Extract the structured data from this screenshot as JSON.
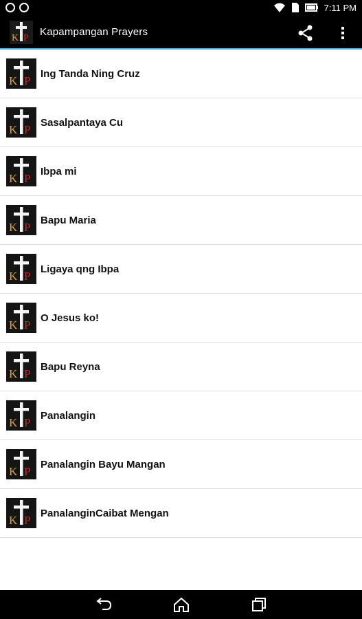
{
  "status_bar": {
    "time": "7:11 PM",
    "icons": [
      "notification-icon",
      "notification-icon",
      "wifi-icon",
      "sim-icon",
      "battery-icon"
    ]
  },
  "app_bar": {
    "title": "Kapampangan Prayers",
    "actions": [
      "share-icon",
      "more-vert-icon"
    ]
  },
  "prayers": [
    {
      "label": "Ing Tanda Ning Cruz"
    },
    {
      "label": "Sasalpantaya Cu"
    },
    {
      "label": "Ibpa mi"
    },
    {
      "label": "Bapu Maria"
    },
    {
      "label": "Ligaya qng Ibpa"
    },
    {
      "label": "O Jesus ko!"
    },
    {
      "label": "Bapu Reyna"
    },
    {
      "label": "Panalangin"
    },
    {
      "label": "Panalangin Bayu Mangan"
    },
    {
      "label": "PanalanginCaibat Mengan"
    }
  ],
  "logo": {
    "letters": [
      "K",
      "P"
    ]
  },
  "nav_bar": {
    "icons": [
      "back-icon",
      "home-icon",
      "recents-icon"
    ]
  },
  "colors": {
    "accent": "#33b5e5",
    "logo_gold": "#d9a23a",
    "logo_red": "#c8281e",
    "bar": "#000000"
  }
}
